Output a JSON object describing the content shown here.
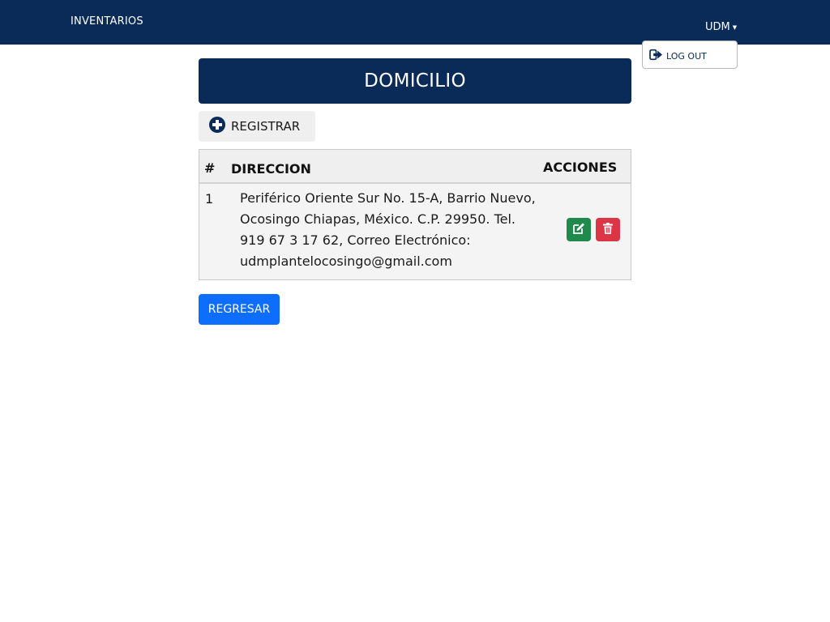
{
  "colors": {
    "navbar": "#0a2b57",
    "title_bar": "#0a2b57",
    "edit_button": "#1f8a4c",
    "delete_button": "#dc3545",
    "back_button": "#0d6efd"
  },
  "navbar": {
    "brand": "INVENTARIOS",
    "user_menu": {
      "label": "UDM",
      "caret_icon": "caret-down-icon"
    }
  },
  "dropdown": {
    "items": [
      {
        "label": "LOG OUT",
        "icon": "sign-out-icon"
      }
    ]
  },
  "page": {
    "title": "DOMICILIO"
  },
  "toolbar": {
    "register_label": "REGISTRAR",
    "register_icon": "plus-circle-icon"
  },
  "table": {
    "headers": {
      "num": "#",
      "address": "DIRECCION",
      "actions": "ACCIONES"
    },
    "rows": [
      {
        "num": "1",
        "address": "Periférico Oriente Sur No. 15-A, Barrio Nuevo, Ocosingo Chiapas, México. C.P. 29950. Tel. 919 67 3 17 62, Correo Electrónico: udmplantelocosingo@gmail.com",
        "edit_icon": "edit-icon",
        "delete_icon": "trash-icon"
      }
    ]
  },
  "footer_actions": {
    "back_label": "REGRESAR"
  }
}
